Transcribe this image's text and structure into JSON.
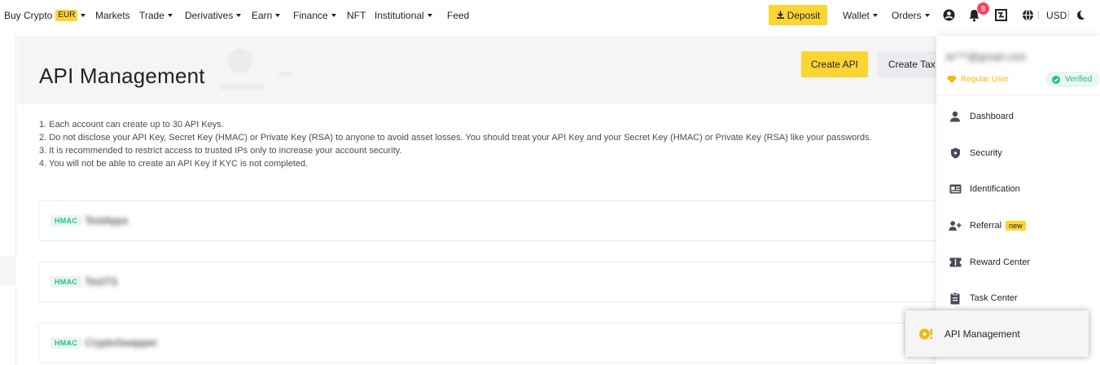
{
  "nav": {
    "buy_crypto": "Buy Crypto",
    "currency_badge": "EUR",
    "markets": "Markets",
    "trade": "Trade",
    "derivatives": "Derivatives",
    "earn": "Earn",
    "finance": "Finance",
    "nft": "NFT",
    "institutional": "Institutional",
    "feed": "Feed",
    "deposit": "Deposit",
    "wallet": "Wallet",
    "orders": "Orders",
    "notification_count": "8",
    "currency": "USD",
    "separator": "|"
  },
  "page": {
    "title": "API Management",
    "create_api": "Create API",
    "create_tax": "Create Tax",
    "notes": [
      "1. Each account can create up to 30 API Keys.",
      "2. Do not disclose your API Key, Secret Key (HMAC) or Private Key (RSA) to anyone to avoid asset losses. You should treat your API Key and your Secret Key (HMAC) or Private Key (RSA) like your passwords.",
      "3. It is recommended to restrict access to trusted IPs only to increase your account security.",
      "4. You will not be able to create an API Key if KYC is not completed."
    ],
    "api_keys": [
      {
        "type": "HMAC",
        "name": "TestApps"
      },
      {
        "type": "HMAC",
        "name": "TestTS"
      },
      {
        "type": "HMAC",
        "name": "CryptoSwapper"
      }
    ]
  },
  "dropdown": {
    "email": "te***@gmail.com",
    "user_level": "Regular User",
    "verified": "Verified",
    "items": [
      {
        "label": "Dashboard",
        "icon": "user-icon"
      },
      {
        "label": "Security",
        "icon": "shield-icon"
      },
      {
        "label": "Identification",
        "icon": "id-card-icon"
      },
      {
        "label": "Referral",
        "icon": "add-user-icon",
        "badge": "new"
      },
      {
        "label": "Reward Center",
        "icon": "ticket-icon"
      },
      {
        "label": "Task Center",
        "icon": "clipboard-icon"
      }
    ],
    "highlighted": {
      "label": "API Management",
      "icon": "api-key-icon"
    }
  },
  "colors": {
    "accent": "#fcd535",
    "text": "#1e2329",
    "success": "#2ebd85",
    "alert": "#f6465d",
    "gold": "#f0b90b"
  }
}
